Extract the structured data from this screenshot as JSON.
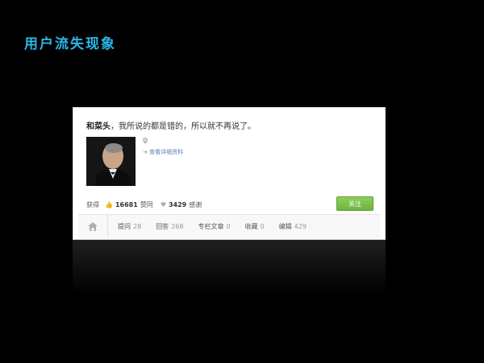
{
  "slide": {
    "title": "用户流失现象"
  },
  "profile": {
    "name": "和菜头",
    "bio": "，我所说的都是错的，所以就不再说了。",
    "detail_link": "查看详细资料",
    "stats": {
      "prefix": "获得",
      "agree_count": "16681",
      "agree_label": "赞同",
      "thanks_count": "3429",
      "thanks_label": "感谢"
    },
    "follow_label": "关注",
    "tabs": [
      {
        "label": "提问",
        "count": "28"
      },
      {
        "label": "回答",
        "count": "268"
      },
      {
        "label": "专栏文章",
        "count": "0"
      },
      {
        "label": "收藏",
        "count": "0"
      },
      {
        "label": "编辑",
        "count": "429"
      }
    ]
  },
  "colors": {
    "title": "#2bb6e8",
    "follow_button": "#7cc24a",
    "link": "#5b7fb0"
  }
}
